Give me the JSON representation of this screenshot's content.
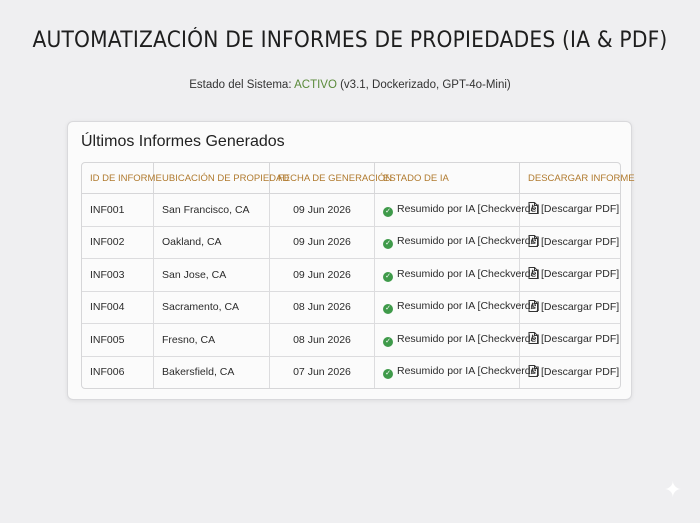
{
  "header": {
    "title": "AUTOMATIZACIÓN DE INFORMES DE PROPIEDADES (IA & PDF)",
    "status_prefix": "Estado del Sistema: ",
    "status_value": "ACTIVO",
    "status_suffix": " (v3.1, Dockerizado, GPT-4o-Mini)"
  },
  "card": {
    "title": "Últimos Informes Generados"
  },
  "table": {
    "columns": [
      "ID DE INFORME",
      "UBICACIÓN DE PROPIEDAD",
      "FECHA DE GENERACIÓN",
      "ESTADO DE IA",
      "DESCARGAR INFORME"
    ],
    "rows": [
      {
        "id": "INF001",
        "location": "San Francisco, CA",
        "date": "09 Jun 2026",
        "status": "Resumido por IA [Checkverde]",
        "download": "[Descargar PDF]"
      },
      {
        "id": "INF002",
        "location": "Oakland, CA",
        "date": "09 Jun 2026",
        "status": "Resumido por IA [Checkverde]",
        "download": "[Descargar PDF]"
      },
      {
        "id": "INF003",
        "location": "San Jose, CA",
        "date": "09 Jun 2026",
        "status": "Resumido por IA [Checkverde]",
        "download": "[Descargar PDF]"
      },
      {
        "id": "INF004",
        "location": "Sacramento, CA",
        "date": "08 Jun 2026",
        "status": "Resumido por IA [Checkverde]",
        "download": "[Descargar PDF]"
      },
      {
        "id": "INF005",
        "location": "Fresno, CA",
        "date": "08 Jun 2026",
        "status": "Resumido por IA [Checkverde]",
        "download": "[Descargar PDF]"
      },
      {
        "id": "INF006",
        "location": "Bakersfield, CA",
        "date": "07 Jun 2026",
        "status": "Resumido por IA [Checkverde]",
        "download": "[Descargar PDF]"
      }
    ]
  },
  "colors": {
    "header_accent": "#b07a2e",
    "active_green": "#5a8a3a",
    "check_green": "#3f9a4a"
  },
  "icons": {
    "status": "check-circle-icon",
    "download": "pdf-file-icon",
    "corner": "sparkle-icon"
  }
}
